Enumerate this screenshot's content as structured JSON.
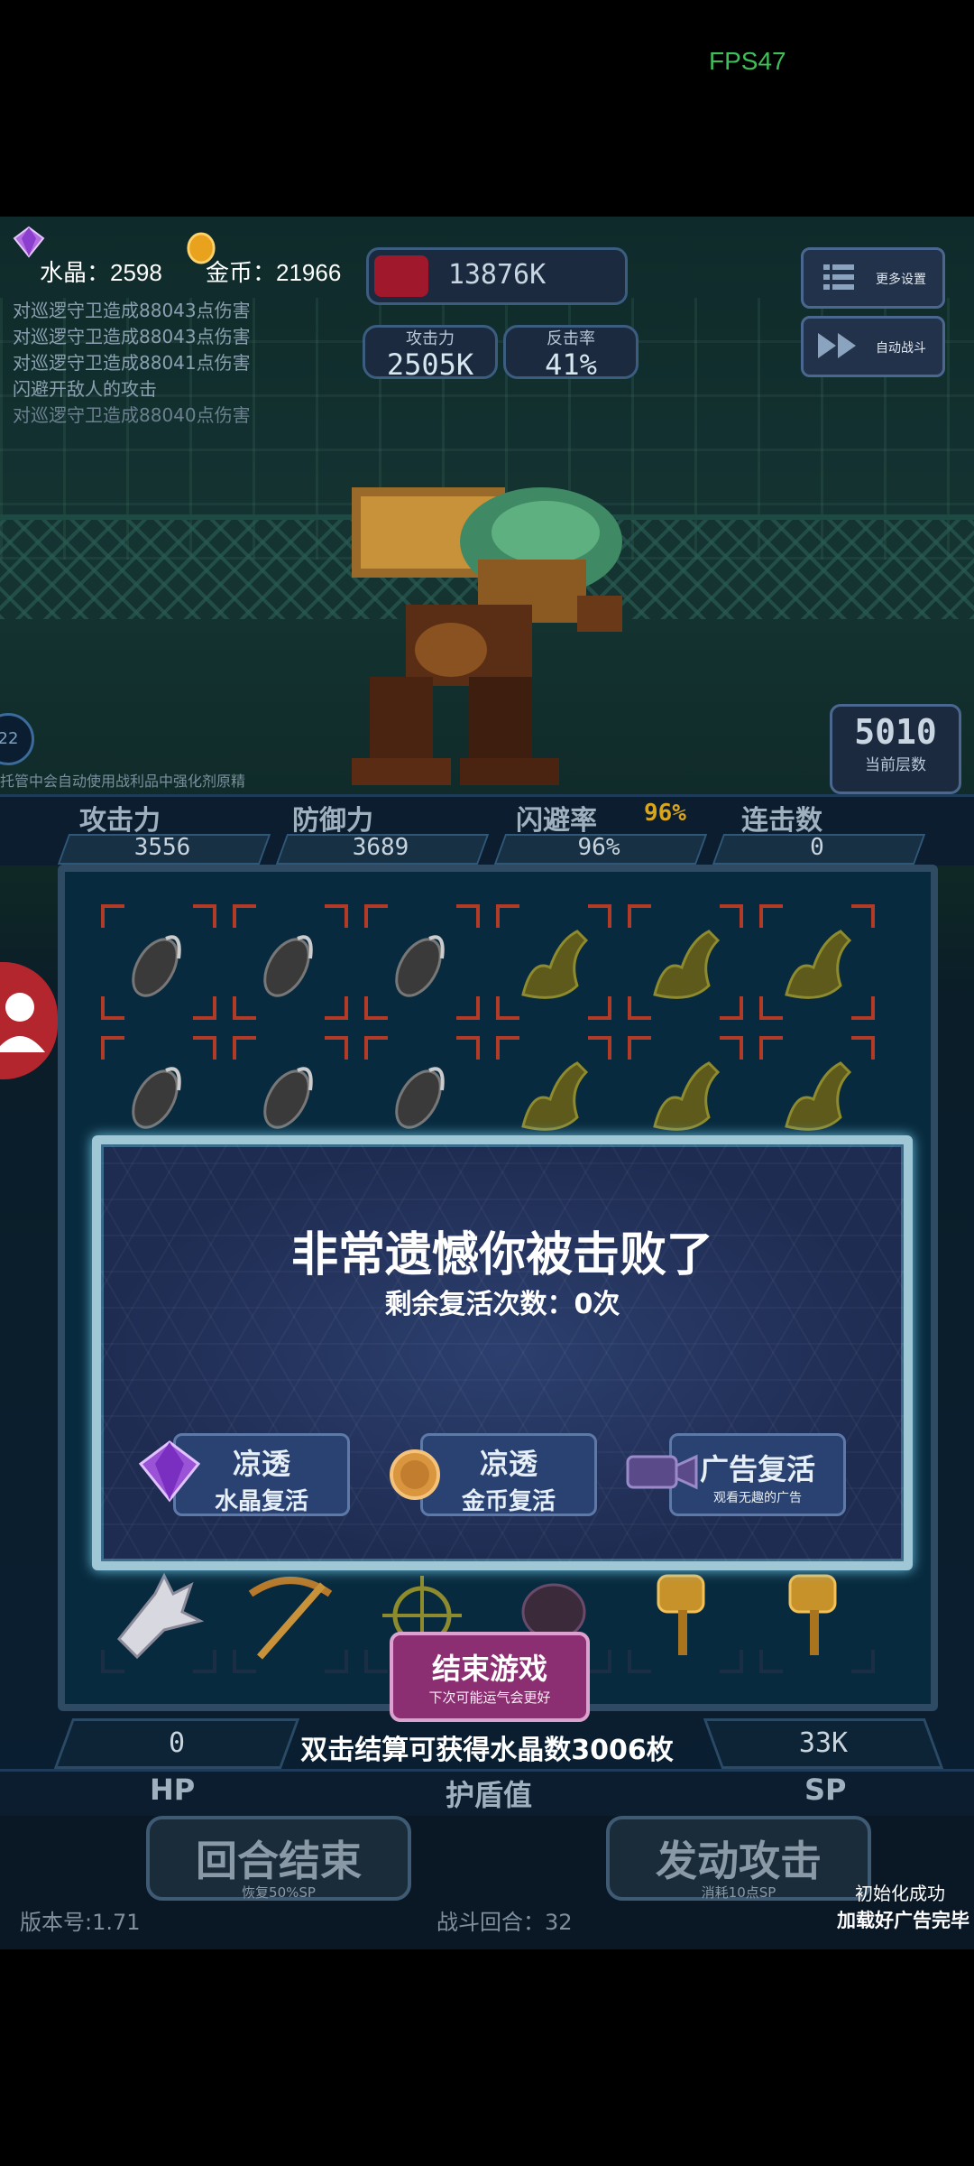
{
  "status_bar": {
    "fps": "FPS47"
  },
  "hud": {
    "crystal_label": "水晶：2598",
    "gold_label": "金币：21966",
    "hp_value": "13876K",
    "hp_fraction": 0.22,
    "attack": {
      "label": "攻击力",
      "value": "2505K"
    },
    "counter": {
      "label": "反击率",
      "value": "41%"
    },
    "more_settings": "更多设置",
    "auto_battle": "自动战斗"
  },
  "battle_log": [
    "对巡逻守卫造成88043点伤害",
    "对巡逻守卫造成88043点伤害",
    "对巡逻守卫造成88041点伤害",
    "闪避开敌人的攻击",
    "对巡逻守卫造成88040点伤害"
  ],
  "hint": "托管中会自动使用战利品中强化剂原精",
  "left_badge": "22",
  "floor": {
    "value": "5010",
    "label": "当前层数"
  },
  "player_stats": [
    {
      "label": "攻击力",
      "value": "3556"
    },
    {
      "label": "防御力",
      "value": "3689"
    },
    {
      "label": "闪避率",
      "value": "96%",
      "extra": "96%"
    },
    {
      "label": "连击数",
      "value": "0"
    }
  ],
  "modal": {
    "title": "非常遗憾你被击败了",
    "subtitle": "剩余复活次数：0次",
    "buttons": [
      {
        "line1": "凉透",
        "line2": "水晶复活"
      },
      {
        "line1": "凉透",
        "line2": "金币复活"
      },
      {
        "line1": "广告复活",
        "line2": "观看无趣的广告"
      }
    ]
  },
  "end_game": {
    "label": "结束游戏",
    "sub": "下次可能运气会更好"
  },
  "settle_text": "双击结算可获得水晶数3006枚",
  "bottom": {
    "hp_value": "0",
    "sp_value": "33K",
    "hp_label": "HP",
    "shield_label": "护盾值",
    "sp_label": "SP",
    "round_end": {
      "label": "回合结束",
      "sub": "恢复50%SP"
    },
    "attack": {
      "label": "发动攻击",
      "sub": "消耗10点SP"
    },
    "version": "版本号:1.71",
    "battle_round": "战斗回合：32"
  },
  "toasts": [
    "初始化成功",
    "加载好广告完毕"
  ],
  "colors": {
    "accent_red": "#b23b28",
    "modal_border": "#9fc7d6",
    "end_button": "#8c2f72",
    "fps": "#3fbf5a"
  }
}
